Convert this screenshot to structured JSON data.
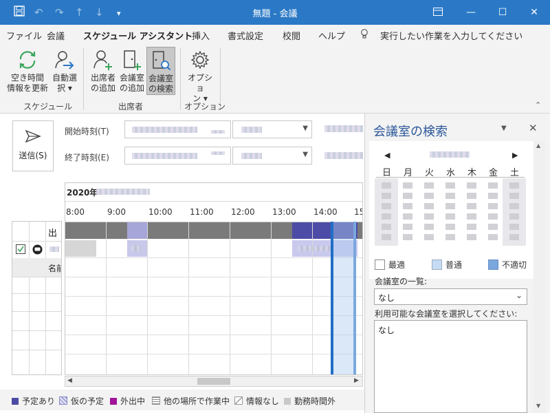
{
  "window": {
    "title": "無題 - 会議",
    "quick_access": [
      "save-icon",
      "undo-icon",
      "redo-icon",
      "up-icon",
      "down-icon",
      "customize-icon"
    ],
    "controls": [
      "restore-ribbon-icon",
      "minimize-icon",
      "maximize-icon",
      "close-icon"
    ]
  },
  "tabs": [
    {
      "label": "ファイル"
    },
    {
      "label": "会議"
    },
    {
      "label": "スケジュール アシスタント"
    },
    {
      "label": "挿入"
    },
    {
      "label": "書式設定"
    },
    {
      "label": "校閲"
    },
    {
      "label": "ヘルプ"
    }
  ],
  "tell_me": "実行したい作業を入力してください",
  "ribbon": {
    "refresh_label": "空き時間\n情報を更新",
    "autopick_label": "自動選\n択 ▾",
    "add_attendees_label": "出席者\nの追加",
    "add_rooms_label": "会議室\nの追加",
    "room_finder_label": "会議室\nの検索",
    "options_label": "オプショ\nン ▾",
    "groups": {
      "schedule": "スケジュール",
      "attendees": "出席者",
      "options": "オプション"
    }
  },
  "form": {
    "send_label": "送信(S)",
    "start_label": "開始時刻(T)",
    "end_label": "終了時刻(E)"
  },
  "schedule": {
    "date_label": "2020年",
    "hours": [
      "8:00",
      "9:00",
      "10:00",
      "11:00",
      "12:00",
      "13:00",
      "14:00",
      "15"
    ],
    "attendee_header": "出",
    "name_header": "名前"
  },
  "legend": [
    {
      "label": "予定あり",
      "color": "#4c4ca6"
    },
    {
      "label": "仮の予定",
      "color": "#a6a6d9"
    },
    {
      "label": "外出中",
      "color": "#a0149a"
    },
    {
      "label": "他の場所で作業中",
      "color": "#888888"
    },
    {
      "label": "情報なし",
      "color": "#999999"
    },
    {
      "label": "勤務時間外",
      "color": "#c8c8c8"
    }
  ],
  "room_finder": {
    "title": "会議室の検索",
    "weekdays": [
      "日",
      "月",
      "火",
      "水",
      "木",
      "金",
      "土"
    ],
    "availability": [
      {
        "label": "最適",
        "color": "#ffffff"
      },
      {
        "label": "普通",
        "color": "#c5dcf4"
      },
      {
        "label": "不適切",
        "color": "#7aa7de"
      }
    ],
    "room_list_label": "会議室の一覧:",
    "room_list_value": "なし",
    "available_rooms_label": "利用可能な会議室を選択してください:",
    "available_rooms_value": "なし"
  }
}
